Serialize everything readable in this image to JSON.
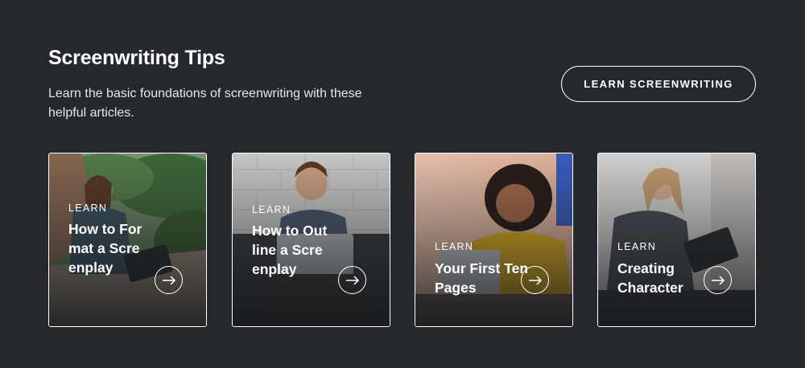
{
  "header": {
    "title": "Screenwriting Tips",
    "subtitle": "Learn the basic foundations of screenwriting with these helpful articles.",
    "cta_label": "LEARN SCREENWRITING"
  },
  "cards": [
    {
      "eyebrow": "LEARN",
      "title": "How to Format a Screenplay"
    },
    {
      "eyebrow": "LEARN",
      "title": "How to Outline a Screenplay"
    },
    {
      "eyebrow": "LEARN",
      "title": "Your First Ten Pages"
    },
    {
      "eyebrow": "LEARN",
      "title": "Creating Character"
    }
  ],
  "icons": {
    "card_action": "arrow-right-icon"
  },
  "colors": {
    "background": "#25282c",
    "text": "#ffffff",
    "accent_yellow": "#e8b51f"
  }
}
